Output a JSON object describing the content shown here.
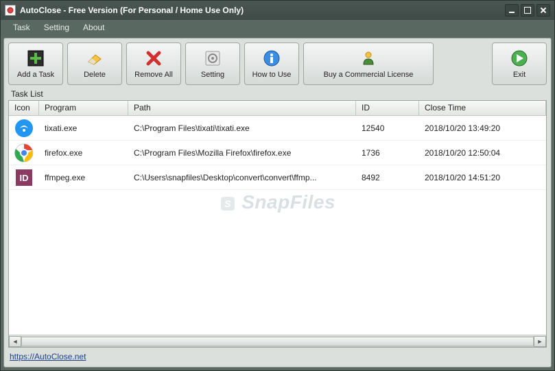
{
  "title": "AutoClose - Free Version (For Personal / Home Use Only)",
  "menu": {
    "task": "Task",
    "setting": "Setting",
    "about": "About"
  },
  "toolbar": {
    "add": "Add a Task",
    "delete": "Delete",
    "remove_all": "Remove All",
    "setting": "Setting",
    "howto": "How to Use",
    "buy": "Buy a Commercial License",
    "exit": "Exit"
  },
  "task_list_label": "Task List",
  "columns": {
    "icon": "Icon",
    "program": "Program",
    "path": "Path",
    "id": "ID",
    "time": "Close Time"
  },
  "rows": [
    {
      "program": "tixati.exe",
      "path": "C:\\Program Files\\tixati\\tixati.exe",
      "id": "12540",
      "time": "2018/10/20 13:49:20"
    },
    {
      "program": "firefox.exe",
      "path": "C:\\Program Files\\Mozilla Firefox\\firefox.exe",
      "id": "1736",
      "time": "2018/10/20 12:50:04"
    },
    {
      "program": "ffmpeg.exe",
      "path": "C:\\Users\\snapfiles\\Desktop\\convert\\convert\\ffmp...",
      "id": "8492",
      "time": "2018/10/20 14:51:20"
    }
  ],
  "watermark": "SnapFiles",
  "footer_url": "https://AutoClose.net"
}
